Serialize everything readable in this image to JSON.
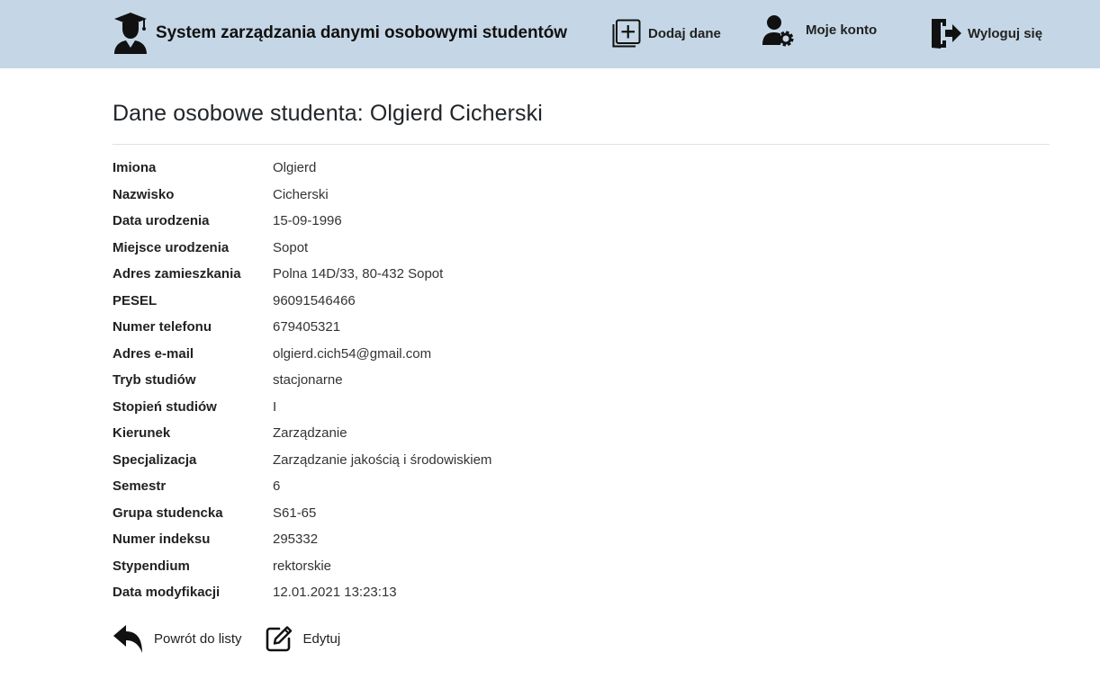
{
  "header": {
    "brand_title": "System zarządzania danymi osobowymi studentów",
    "nav": {
      "add_label": "Dodaj dane",
      "account_label": "Moje konto",
      "logout_label": "Wyloguj się"
    },
    "background_color": "#c5d7e6"
  },
  "main": {
    "title": "Dane osobowe studenta: Olgierd Cicherski",
    "fields": [
      {
        "label": "Imiona",
        "value": "Olgierd"
      },
      {
        "label": "Nazwisko",
        "value": "Cicherski"
      },
      {
        "label": "Data urodzenia",
        "value": "15-09-1996"
      },
      {
        "label": "Miejsce urodzenia",
        "value": "Sopot"
      },
      {
        "label": "Adres zamieszkania",
        "value": "Polna 14D/33, 80-432 Sopot"
      },
      {
        "label": "PESEL",
        "value": "96091546466"
      },
      {
        "label": "Numer telefonu",
        "value": "679405321"
      },
      {
        "label": "Adres e-mail",
        "value": "olgierd.cich54@gmail.com"
      },
      {
        "label": "Tryb studiów",
        "value": "stacjonarne"
      },
      {
        "label": "Stopień studiów",
        "value": "I"
      },
      {
        "label": "Kierunek",
        "value": "Zarządzanie"
      },
      {
        "label": "Specjalizacja",
        "value": "Zarządzanie jakością i środowiskiem"
      },
      {
        "label": "Semestr",
        "value": "6"
      },
      {
        "label": "Grupa studencka",
        "value": "S61-65"
      },
      {
        "label": "Numer indeksu",
        "value": "295332"
      },
      {
        "label": "Stypendium",
        "value": "rektorskie"
      },
      {
        "label": "Data modyfikacji",
        "value": "12.01.2021 13:23:13"
      }
    ],
    "actions": {
      "back_label": "Powrót do listy",
      "edit_label": "Edytuj"
    }
  },
  "icons": {
    "brand": "student-graduate-icon",
    "add": "plus-square-icon",
    "account": "user-gear-icon",
    "logout": "door-exit-icon",
    "back": "reply-arrow-icon",
    "edit": "edit-square-icon"
  }
}
